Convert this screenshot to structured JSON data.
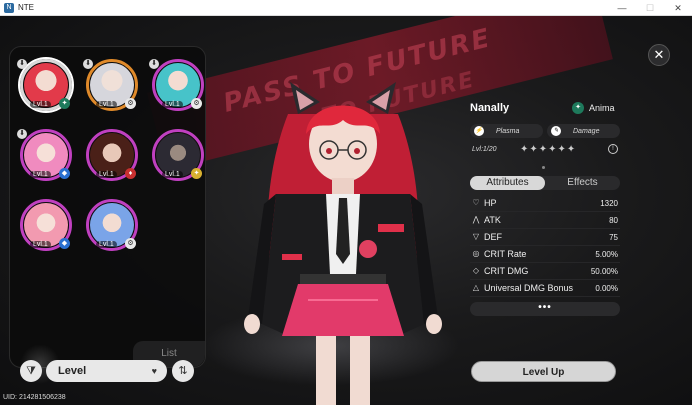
{
  "window": {
    "title": "NTE",
    "icon_label": "N"
  },
  "roster": {
    "list_label": "List",
    "characters": [
      {
        "level": "Lvl.1",
        "ring": "#d9d9d9",
        "elem_color": "#1e7a5c",
        "elem_icon": "anima-icon",
        "hair": "#e23a4a",
        "selected": true
      },
      {
        "level": "Lvl.1",
        "ring": "#e08a2a",
        "elem_color": "#e9e9e9",
        "elem_icon": "gear-icon",
        "hair": "#d6d6dc"
      },
      {
        "level": "Lvl.1",
        "ring": "#c040c0",
        "elem_color": "#e9e9e9",
        "elem_icon": "gear-icon",
        "hair": "#47c3c9"
      },
      {
        "level": "Lvl.1",
        "ring": "#c040c0",
        "elem_color": "#2a70d0",
        "elem_icon": "diamond-icon",
        "hair": "#f08bbf"
      },
      {
        "level": "Lvl.1",
        "ring": "#c040c0",
        "elem_color": "#c83030",
        "elem_icon": "flame-icon",
        "hair": "#4a2018"
      },
      {
        "level": "Lvl.1",
        "ring": "#c040c0",
        "elem_color": "#d8b030",
        "elem_icon": "star-icon",
        "hair": "#2c2a33"
      },
      {
        "level": "Lvl.1",
        "ring": "#c040c0",
        "elem_color": "#2a70d0",
        "elem_icon": "diamond-icon",
        "hair": "#f29ab0"
      },
      {
        "level": "Lvl.1",
        "ring": "#c040c0",
        "elem_color": "#e9e9e9",
        "elem_icon": "gear-icon",
        "hair": "#7aa4e8"
      }
    ]
  },
  "controls": {
    "sort_value": "Level",
    "uid": "UID: 214281506238"
  },
  "character": {
    "name": "Nanally",
    "element": "Anima",
    "tags": [
      "Plasma",
      "Damage"
    ],
    "level_text": "Lvl:1/20",
    "stars": "✦✦✦✦✦✦",
    "tabs": [
      "Attributes",
      "Effects"
    ],
    "active_tab": "Attributes",
    "stats": [
      {
        "name": "HP",
        "value": "1320",
        "icon": "heart-icon",
        "glyph": "♡"
      },
      {
        "name": "ATK",
        "value": "80",
        "icon": "attack-icon",
        "glyph": "⋀"
      },
      {
        "name": "DEF",
        "value": "75",
        "icon": "shield-icon",
        "glyph": "⛉"
      },
      {
        "name": "CRIT Rate",
        "value": "5.00%",
        "icon": "crit-rate-icon",
        "glyph": "◎"
      },
      {
        "name": "CRIT DMG",
        "value": "50.00%",
        "icon": "crit-dmg-icon",
        "glyph": "◇"
      },
      {
        "name": "Universal DMG Bonus",
        "value": "0.00%",
        "icon": "dmg-bonus-icon",
        "glyph": "△"
      }
    ],
    "more_label": "•••",
    "level_up_label": "Level Up"
  },
  "colors": {
    "accent": "#c040c0",
    "banner": "#7a1a28",
    "anima": "#1e7a5c"
  }
}
